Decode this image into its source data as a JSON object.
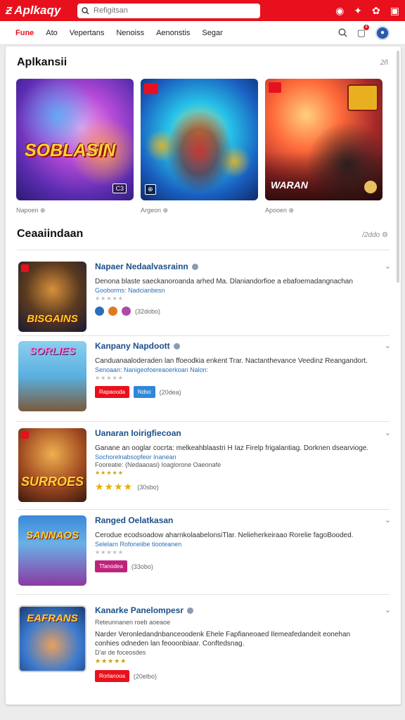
{
  "header": {
    "logo_text": "Aplkaqy",
    "search_placeholder": "Refigitsan",
    "icons": [
      "refresh-icon",
      "bolt-icon",
      "gear-icon",
      "grid-icon"
    ]
  },
  "nav": {
    "tabs": [
      "Fune",
      "Ato",
      "Vepertans",
      "Nenoiss",
      "Aenonstis",
      "Segar"
    ],
    "active_tab": "Fune",
    "notification_count": "4"
  },
  "featured": {
    "title": "Aplkansii",
    "more": "2ñ",
    "cards": [
      {
        "art_title": "SOBLASIN",
        "badge": "C3",
        "caption": "Napoen ⊕"
      },
      {
        "art_title": "",
        "badge": "⊕",
        "caption": "Argeon ⊕"
      },
      {
        "art_title": "WARAN",
        "badge": "",
        "caption": "Apooen ⊕"
      }
    ]
  },
  "list": {
    "title": "Ceaaiindaan",
    "more": "/2ddo",
    "items": [
      {
        "name": "Napaer Nedaalvasrainn",
        "desc": "Denona blaste saeckanoroanda arhed Ma. Dlaniandorfioe a ebafoemadangnachan",
        "sub": "Gooborms: Nadcianbesn",
        "thumb_title": "BISGAINS",
        "count": "(32dobo)",
        "buttons": []
      },
      {
        "name": "Kanpany Napdoott",
        "desc": "Canduanaaloderaden lan ffoeodkia enkent Trar. Nactanthevance Veedinz Reangandort.",
        "sub": "Senoaan: Nanigeofoereaoerkoan Nalon:",
        "thumb_title": "SORLIES",
        "count": "(20dea)",
        "buttons": [
          "Rapaooda",
          "Ndso"
        ]
      },
      {
        "name": "Uanaran Ioirigfiecoan",
        "desc": "Ganane an ooglar cocrta: melkeahblaastri H Iaz Firelp frigalantiag. Dorknen dsearvioge.",
        "sub": "Sochorelnabsopfeor Inanean",
        "sub2": "Fooreatie: (Nedaaoasi)          Ioaglorone Oaeonafe",
        "thumb_title": "SURROES",
        "count": "(30sbo)",
        "buttons": []
      },
      {
        "name": "Ranged Oelatkasan",
        "desc": "Cerodue ecodsoadow aharnkolaabelonsiTlar. Nelieherkeiraao Rorelie fagoBooded.",
        "sub": "Selelarn Rofoneiibe tiooteanen",
        "thumb_title": "SANNAOS",
        "count": "(33obo)",
        "buttons": [
          "Tfanodea"
        ]
      },
      {
        "name": "Kanarke Panelompesr",
        "pre": "Reteunnanen roeb aoeaoe",
        "desc": "Narder Veronledandnbanceoodenk Ehele Fapfianeoaed Ilemeafedandeit eonehan conhies odneden lan feooonbiaar. Conftedsnag.",
        "sub": "D'ar de foceosdes",
        "thumb_title": "EAFRANS",
        "count": "(20elbo)",
        "buttons": [
          "Rorlanooa"
        ]
      }
    ]
  },
  "colors": {
    "brand": "#e8101c",
    "link": "#1b4f8a",
    "blue_button": "#2f88d8",
    "pink_button": "#c0227a"
  }
}
